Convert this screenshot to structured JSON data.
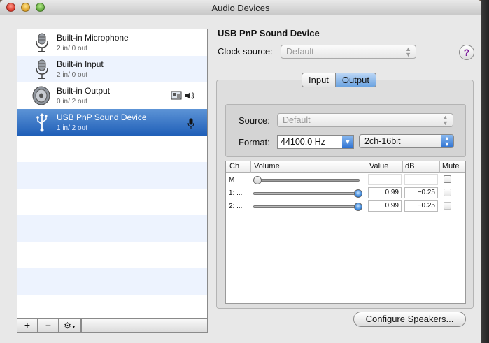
{
  "window": {
    "title": "Audio Devices"
  },
  "devices": [
    {
      "name": "Built-in Microphone",
      "io": "2 in/ 0 out",
      "icon": "microphone-icon",
      "selected": false
    },
    {
      "name": "Built-in Input",
      "io": "2 in/ 0 out",
      "icon": "microphone-icon",
      "selected": false
    },
    {
      "name": "Built-in Output",
      "io": "0 in/ 2 out",
      "icon": "speaker-icon",
      "selected": false,
      "badges": [
        "finder-icon",
        "volume-icon"
      ]
    },
    {
      "name": "USB PnP Sound Device",
      "io": "1 in/ 2 out",
      "icon": "usb-icon",
      "selected": true,
      "badges": [
        "microphone-badge-icon"
      ]
    }
  ],
  "list_toolbar": {
    "add": "+",
    "remove": "−",
    "gear": "gear-icon"
  },
  "detail": {
    "device_title": "USB PnP Sound Device",
    "clock_label": "Clock source:",
    "clock_value": "Default",
    "help": "?",
    "tabs": [
      {
        "label": "Input",
        "active": false
      },
      {
        "label": "Output",
        "active": true
      }
    ],
    "source_label": "Source:",
    "source_value": "Default",
    "format_label": "Format:",
    "format_rate": "44100.0 Hz",
    "format_bits": "2ch-16bit",
    "table": {
      "headers": {
        "ch": "Ch",
        "volume": "Volume",
        "value": "Value",
        "db": "dB",
        "mute": "Mute"
      },
      "rows": [
        {
          "ch": "M",
          "level": 0.0,
          "value": "",
          "db": "",
          "mute_enabled": true
        },
        {
          "ch": "1: ...",
          "level": 1.0,
          "value": "0.99",
          "db": "−0.25",
          "mute_enabled": false
        },
        {
          "ch": "2: ...",
          "level": 1.0,
          "value": "0.99",
          "db": "−0.25",
          "mute_enabled": false
        }
      ]
    },
    "configure_label": "Configure Speakers..."
  },
  "colors": {
    "selection": "#2f6fc4",
    "stripe": "#edf3fe",
    "accent": "#3a7ddb"
  }
}
